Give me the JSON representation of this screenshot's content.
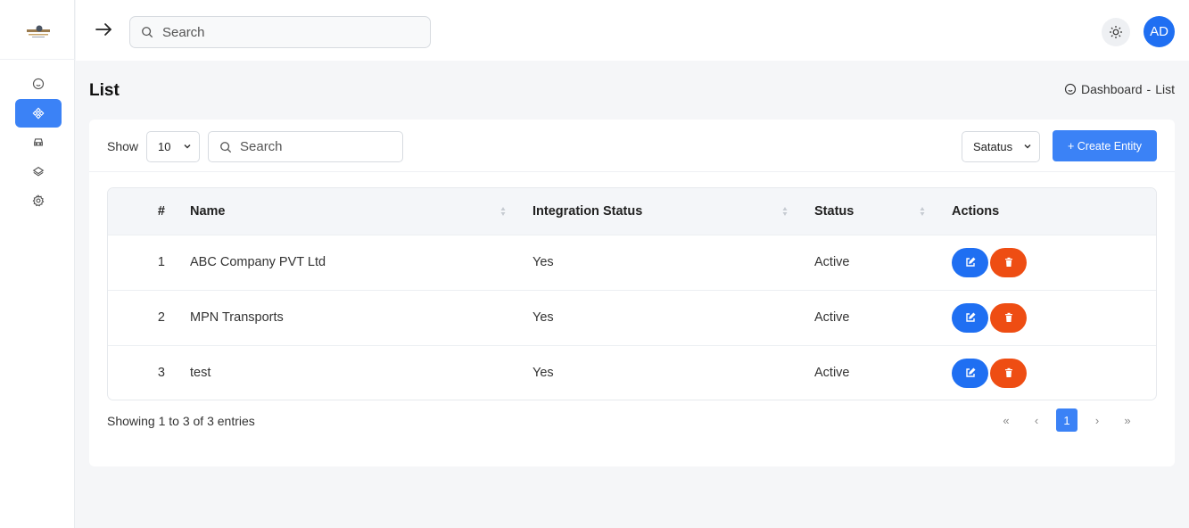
{
  "sidebar": {
    "logo_icon": "company-logo",
    "items": [
      {
        "name": "sidebar-item-home",
        "icon": "home-icon",
        "active": false
      },
      {
        "name": "sidebar-item-integrations",
        "icon": "diamond-grid-icon",
        "active": true
      },
      {
        "name": "sidebar-item-vehicles",
        "icon": "car-icon",
        "active": false
      },
      {
        "name": "sidebar-item-layers",
        "icon": "layers-icon",
        "active": false
      },
      {
        "name": "sidebar-item-settings",
        "icon": "gear-icon",
        "active": false
      }
    ]
  },
  "topbar": {
    "search_placeholder": "Search",
    "avatar_initials": "AD"
  },
  "page": {
    "title": "List",
    "breadcrumb_home": "Dashboard",
    "breadcrumb_sep": "-",
    "breadcrumb_current": "List"
  },
  "toolbar": {
    "show_label": "Show",
    "page_size": "10",
    "search_placeholder": "Search",
    "status_filter": "Satatus",
    "create_label": "+ Create Entity"
  },
  "table": {
    "columns": [
      "#",
      "Name",
      "Integration Status",
      "Status",
      "Actions"
    ],
    "rows": [
      {
        "num": "1",
        "name": "ABC Company PVT Ltd",
        "integration": "Yes",
        "status": "Active"
      },
      {
        "num": "2",
        "name": "MPN Transports",
        "integration": "Yes",
        "status": "Active"
      },
      {
        "num": "3",
        "name": "test",
        "integration": "Yes",
        "status": "Active"
      }
    ]
  },
  "footer": {
    "entries_text": "Showing 1 to 3 of 3 entries",
    "pagination": {
      "first": "«",
      "prev": "‹",
      "current": "1",
      "next": "›",
      "last": "»"
    }
  },
  "colors": {
    "primary": "#3b82f6",
    "edit": "#1f6ff2",
    "delete": "#ee4d13",
    "background": "#f5f6f8"
  }
}
